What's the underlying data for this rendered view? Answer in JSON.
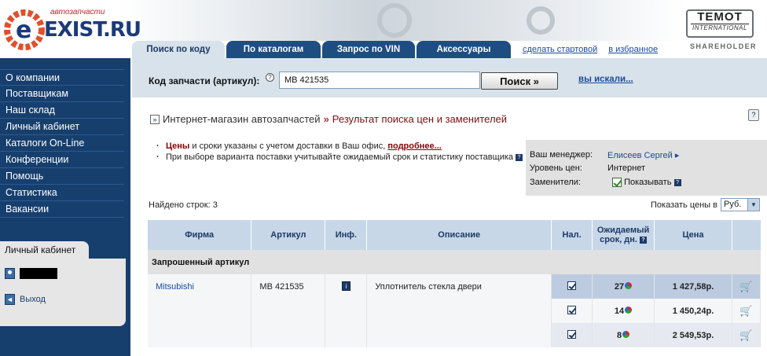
{
  "header": {
    "logo_tagline": "автозапчасти",
    "logo_name": "EXIST.RU",
    "partner_title": "TEMOT",
    "partner_sub": "INTERNATIONAL",
    "partner_caption": "SHAREHOLDER"
  },
  "tabs": [
    {
      "label": "Поиск по коду",
      "active": true
    },
    {
      "label": "По каталогам",
      "active": false
    },
    {
      "label": "Запрос по VIN",
      "active": false
    },
    {
      "label": "Аксессуары",
      "active": false
    }
  ],
  "top_links": {
    "make_start": "сделать стартовой",
    "favorites": "в избранное"
  },
  "sidebar": {
    "items": [
      "О компании",
      "Поставщикам",
      "Наш склад",
      "Личный кабинет",
      "Каталоги On-Line",
      "Конференции",
      "Помощь",
      "Статистика",
      "Вакансии"
    ],
    "cabinet_title": "Личный кабинет",
    "logout_label": "Выход"
  },
  "search": {
    "label": "Код запчасти (артикул):",
    "value": "MB 421535",
    "button": "Поиск »",
    "recent_link": "вы искали..."
  },
  "breadcrumb": {
    "link": "Интернет-магазин автозапчастей",
    "separator": "»",
    "current": "Результат поиска цен и заменителей"
  },
  "notes": {
    "n1_red": "Цены",
    "n1_text": " и сроки указаны с учетом доставки в Ваш офис, ",
    "n1_link": "подробнее...",
    "n2_text": "При выборе варианта поставки учитывайте ожидаемый срок и статистику поставщика"
  },
  "info_panel": {
    "manager_key": "Ваш менеджер:",
    "manager_val": "Елисеев Сергей",
    "price_level_key": "Уровень цен:",
    "price_level_val": "Интернет",
    "replacements_key": "Заменители:",
    "replacements_val": "Показывать"
  },
  "found": "Найдено строк: 3",
  "price_currency": {
    "label": "Показать цены в",
    "value": "Руб."
  },
  "table": {
    "headers": {
      "firm": "Фирма",
      "article": "Артикул",
      "info": "Инф.",
      "description": "Описание",
      "stock": "Нал.",
      "expected": "Ожидаемый срок, дн.",
      "price": "Цена"
    },
    "group_label": "Запрошенный артикул",
    "firm": "Mitsubishi",
    "article": "MB 421535",
    "description": "Уплотнитель стекла двери",
    "offers": [
      {
        "days": "27",
        "price": "1 427,58р."
      },
      {
        "days": "14",
        "price": "1 450,24р."
      },
      {
        "days": "8",
        "price": "2 549,53р."
      }
    ]
  },
  "colors": {
    "navy": "#173f6e",
    "tab": "#1e4d82",
    "search_bg": "#d8e2ea",
    "header_table": "#c7d7e8",
    "highlight": "#bccbe0",
    "accent_red": "#8b0000"
  }
}
